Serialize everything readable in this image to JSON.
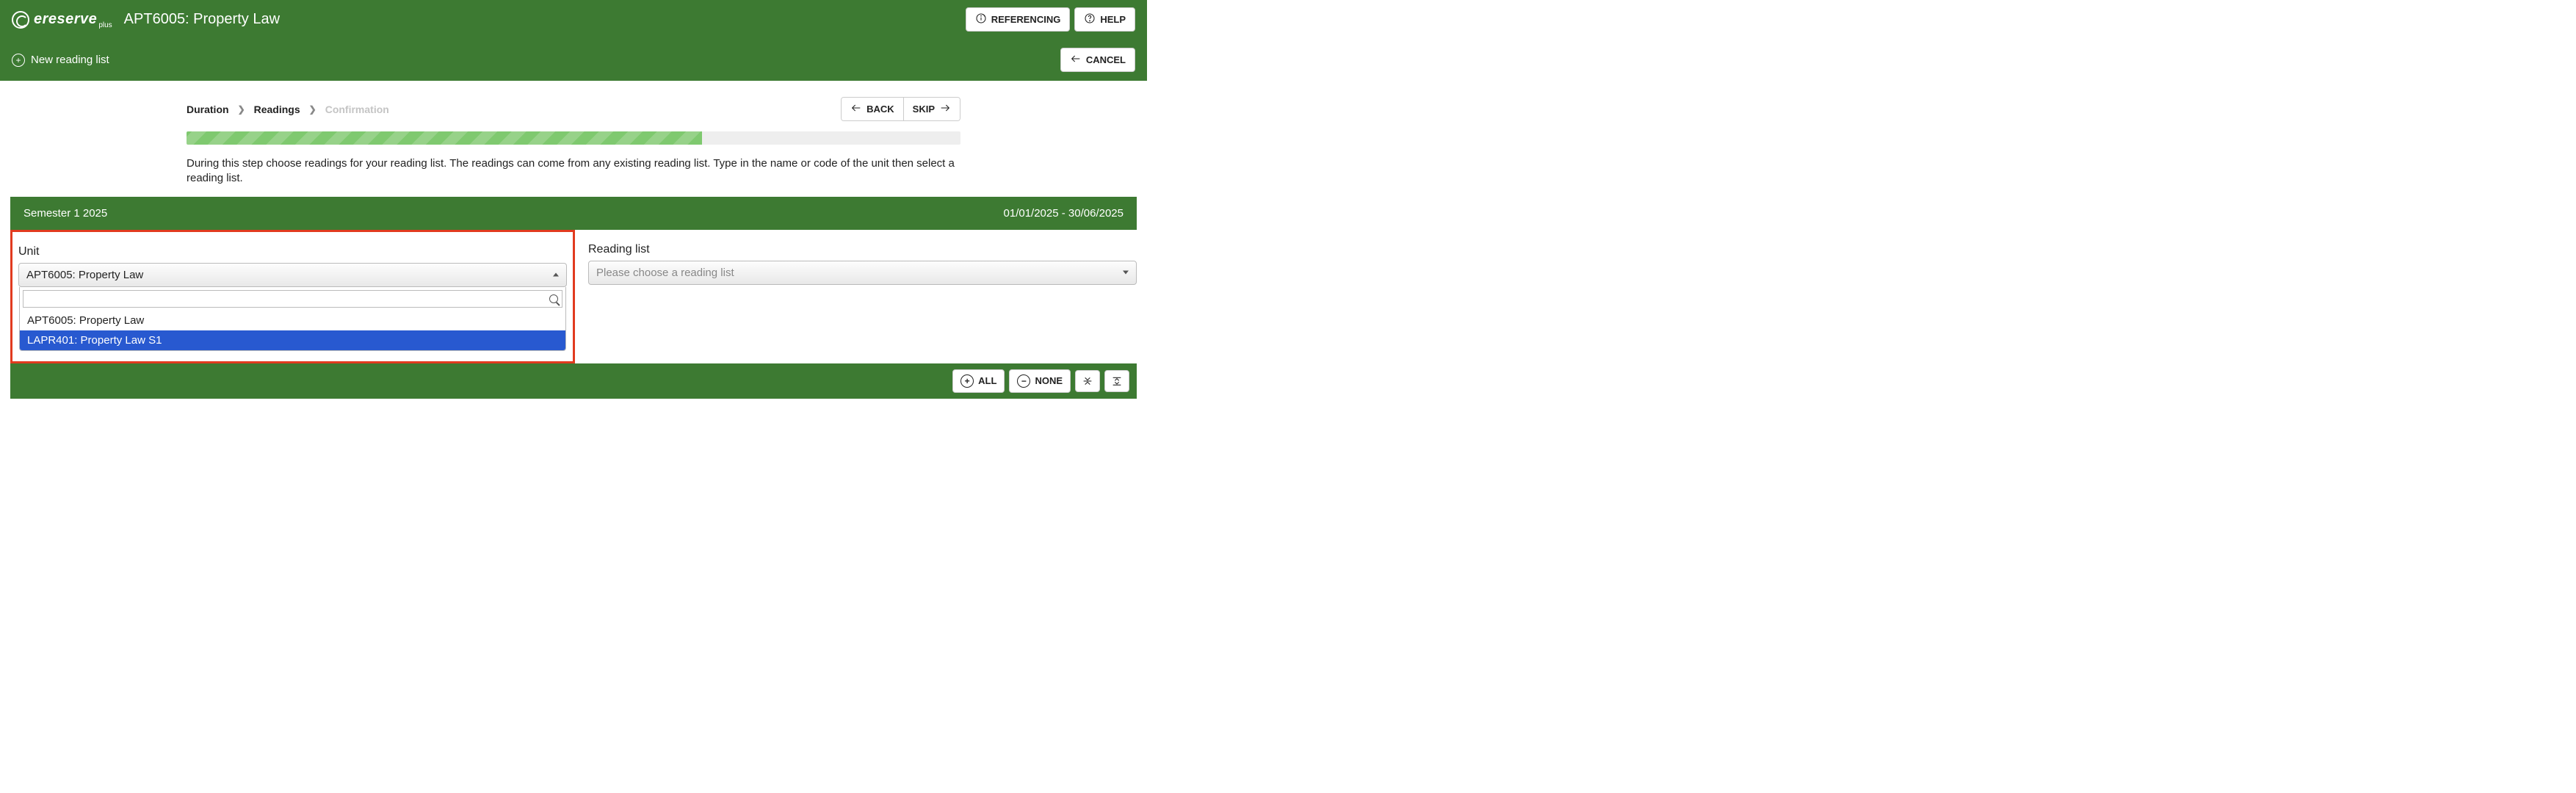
{
  "header": {
    "logo": "ereserve",
    "logo_plus": "plus",
    "title": "APT6005: Property Law",
    "referencing_label": "REFERENCING",
    "help_label": "HELP",
    "new_list_label": "New reading list",
    "cancel_label": "CANCEL"
  },
  "wizard": {
    "crumbs": {
      "a": "Duration",
      "b": "Readings",
      "c": "Confirmation"
    },
    "back_label": "BACK",
    "skip_label": "SKIP",
    "desc": "During this step choose readings for your reading list. The readings can come from any existing reading list. Type in the name or code of the unit then select a reading list."
  },
  "semester": {
    "name": "Semester 1 2025",
    "range": "01/01/2025 - 30/06/2025"
  },
  "form": {
    "unit_label": "Unit",
    "unit_value": "APT6005: Property Law",
    "unit_options": [
      "APT6005: Property Law",
      "LAPR401: Property Law S1"
    ],
    "unit_option_0": "APT6005: Property Law",
    "unit_option_1": "LAPR401: Property Law S1",
    "unit_search": "",
    "reading_label": "Reading list",
    "reading_placeholder": "Please choose a reading list"
  },
  "footer": {
    "all_label": "ALL",
    "none_label": "NONE"
  }
}
